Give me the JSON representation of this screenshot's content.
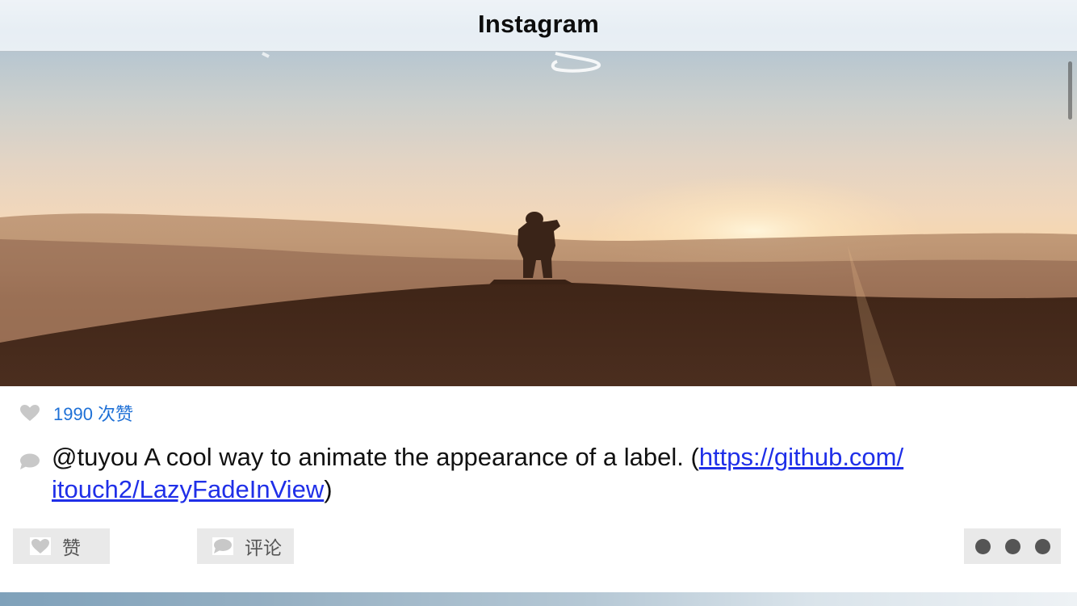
{
  "navbar": {
    "title": "Instagram"
  },
  "post": {
    "likes_text": "1990 次赞",
    "caption": {
      "prefix": "@tuyou A cool way to animate the appearance of a label. (",
      "link_line1": "https://github.com/",
      "link_line2": "itouch2/LazyFadeInView",
      "suffix": ")"
    },
    "actions": {
      "like_label": "赞",
      "comment_label": "评论"
    }
  },
  "icons": {
    "heart": "heart-icon",
    "comment": "comment-bubble-icon",
    "more": "more-dots-icon"
  },
  "colors": {
    "likes_text": "#1e70d6",
    "link": "#1f2fe8",
    "button_bg": "#e9e9e9",
    "icon_gray": "#c8c8c8"
  }
}
